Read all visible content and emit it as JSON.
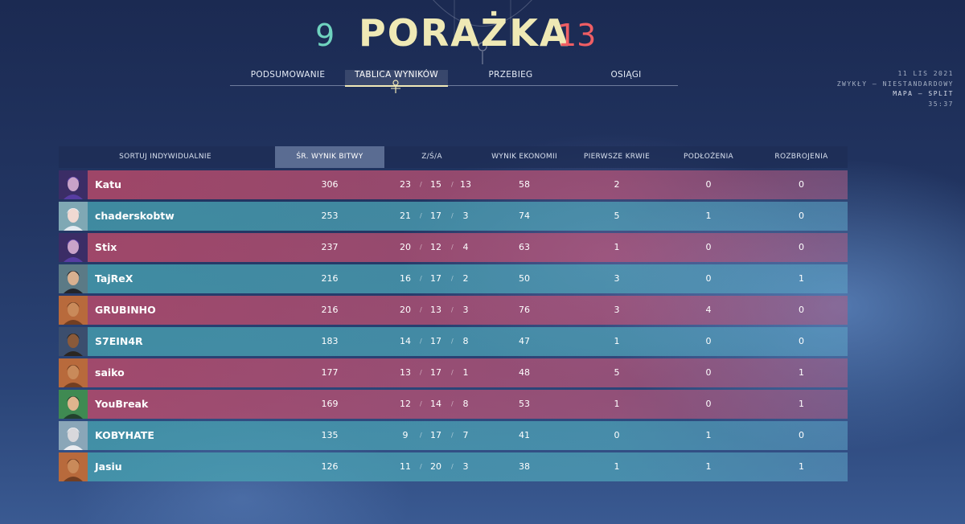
{
  "header": {
    "score_left": "9",
    "result": "PORAŻKA",
    "score_right": "13"
  },
  "tabs": [
    {
      "label": "PODSUMOWANIE",
      "active": false
    },
    {
      "label": "TABLICA WYNIKÓW",
      "active": true
    },
    {
      "label": "PRZEBIEG",
      "active": false
    },
    {
      "label": "OSIĄGI",
      "active": false
    }
  ],
  "match_info": {
    "date": "11 LIS 2021",
    "mode": "ZWYKŁY – NIESTANDARDOWY",
    "map": "MAPA – SPLIT",
    "duration": "35:37"
  },
  "columns": {
    "sort": "SORTUJ INDYWIDUALNIE",
    "acs": "ŚR. WYNIK BITWY",
    "kda": "Z/Ś/A",
    "econ": "WYNIK EKONOMII",
    "first_bloods": "PIERWSZE KRWIE",
    "plants": "PODŁOŻENIA",
    "defuses": "ROZBROJENIA"
  },
  "colors": {
    "enemy_row": "#c34b69",
    "ally_row": "#46a0af",
    "win_score": "#6fd3bf",
    "loss_score": "#ef5e64",
    "title": "#efe9b5"
  },
  "players": [
    {
      "name": "Katu",
      "team": "enemy",
      "agent_icon": "agent-portrait-purple",
      "acs": "306",
      "k": "23",
      "d": "15",
      "a": "13",
      "econ": "58",
      "fb": "2",
      "plants": "0",
      "defuses": "0"
    },
    {
      "name": "chaderskobtw",
      "team": "ally",
      "agent_icon": "agent-portrait-white-hair",
      "acs": "253",
      "k": "21",
      "d": "17",
      "a": "3",
      "econ": "74",
      "fb": "5",
      "plants": "1",
      "defuses": "0"
    },
    {
      "name": "Stix",
      "team": "enemy",
      "agent_icon": "agent-portrait-purple",
      "acs": "237",
      "k": "20",
      "d": "12",
      "a": "4",
      "econ": "63",
      "fb": "1",
      "plants": "0",
      "defuses": "0"
    },
    {
      "name": "TajReX",
      "team": "ally",
      "agent_icon": "agent-portrait-dark-hair",
      "acs": "216",
      "k": "16",
      "d": "17",
      "a": "2",
      "econ": "50",
      "fb": "3",
      "plants": "0",
      "defuses": "1"
    },
    {
      "name": "GRUBINHO",
      "team": "enemy",
      "agent_icon": "agent-portrait-orange",
      "acs": "216",
      "k": "20",
      "d": "13",
      "a": "3",
      "econ": "76",
      "fb": "3",
      "plants": "4",
      "defuses": "0"
    },
    {
      "name": "S7EIN4R",
      "team": "ally",
      "agent_icon": "agent-portrait-dark",
      "acs": "183",
      "k": "14",
      "d": "17",
      "a": "8",
      "econ": "47",
      "fb": "1",
      "plants": "0",
      "defuses": "0",
      "self": true
    },
    {
      "name": "saiko",
      "team": "enemy",
      "agent_icon": "agent-portrait-orange",
      "acs": "177",
      "k": "13",
      "d": "17",
      "a": "1",
      "econ": "48",
      "fb": "5",
      "plants": "0",
      "defuses": "1"
    },
    {
      "name": "YouBreak",
      "team": "enemy",
      "agent_icon": "agent-portrait-green",
      "acs": "169",
      "k": "12",
      "d": "14",
      "a": "8",
      "econ": "53",
      "fb": "1",
      "plants": "0",
      "defuses": "1"
    },
    {
      "name": "KOBYHATE",
      "team": "ally",
      "agent_icon": "agent-portrait-white-hat",
      "acs": "135",
      "k": "9",
      "d": "17",
      "a": "7",
      "econ": "41",
      "fb": "0",
      "plants": "1",
      "defuses": "0"
    },
    {
      "name": "Jasiu",
      "team": "ally",
      "agent_icon": "agent-portrait-orange",
      "acs": "126",
      "k": "11",
      "d": "20",
      "a": "3",
      "econ": "38",
      "fb": "1",
      "plants": "1",
      "defuses": "1"
    }
  ]
}
